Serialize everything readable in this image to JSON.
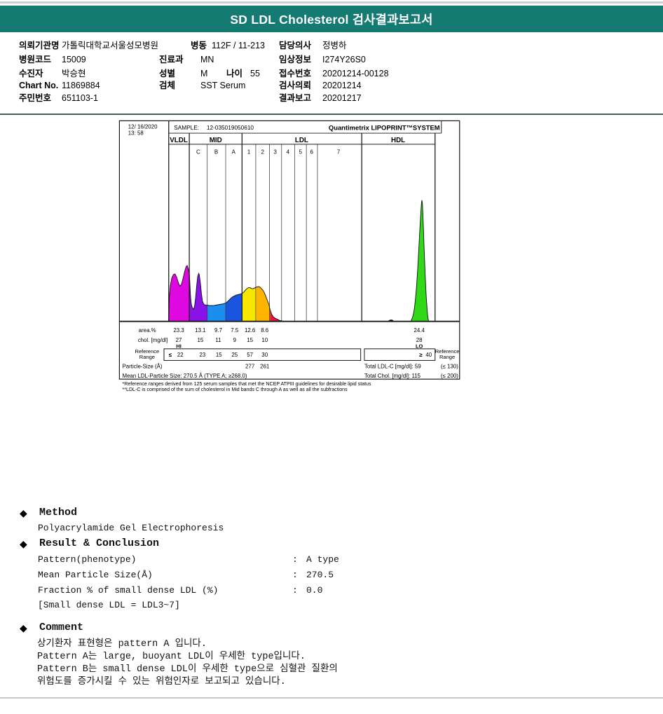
{
  "page": {
    "title": "SD LDL Cholesterol 검사결과보고서"
  },
  "patient": {
    "rows": [
      {
        "l1": "의뢰기관명",
        "v1": "가톨릭대학교서울성모병원",
        "l2": "병동",
        "v2": "112F / 11-213",
        "l3": "담당의사",
        "v3": "정병하"
      },
      {
        "l1": "병원코드",
        "v1": "15009",
        "l2": "진료과",
        "v2": "MN",
        "l3": "임상정보",
        "v3": "I274Y26S0"
      },
      {
        "l1": "수진자",
        "v1": "박승현",
        "l2": "성별",
        "v2": "M",
        "l2b": "나이",
        "v2b": "55",
        "l3": "접수번호",
        "v3": "20201214-00128"
      },
      {
        "l1": "Chart No.",
        "v1": "11869884",
        "l2": "검체",
        "v2": "SST Serum",
        "l3": "검사의뢰",
        "v3": "20201214"
      },
      {
        "l1": "주민번호",
        "v1": "651103-1",
        "l3": "결과보고",
        "v3": "20201217"
      }
    ]
  },
  "chart": {
    "datetime_line1": "12/ 16/2020",
    "datetime_line2": "13: 58",
    "sample_label": "SAMPLE:",
    "sample_id": "12-035019050610",
    "brand": "Quantimetrix LIPOPRINT™SYSTEM",
    "brand_color": "#ee00ee",
    "groups": [
      "VLDL",
      "MID",
      "LDL",
      "HDL"
    ],
    "subbands": [
      "C",
      "B",
      "A",
      "1",
      "2",
      "3",
      "4",
      "5",
      "6",
      "7"
    ],
    "row_labels": {
      "area": "area.%",
      "chol": "chol. [mg/dl]",
      "ref_line1": "Reference",
      "ref_line2": "Range",
      "particle": "Particle-Size (Å)"
    },
    "area": [
      "23.3",
      "13.1",
      "9.7",
      "7.5",
      "12.6",
      "8.6",
      "24.4"
    ],
    "chol": [
      "27",
      "15",
      "11",
      "9",
      "15",
      "10",
      "28"
    ],
    "flags": {
      "hi": "HI",
      "lo": "LO"
    },
    "ref": {
      "le": "≤",
      "values": [
        "22",
        "23",
        "15",
        "25",
        "57",
        "30"
      ],
      "ge": "≥",
      "hdl": "40"
    },
    "particle_values": [
      "277",
      "261"
    ],
    "mean_line": "Mean LDL-Particle Size:  270.5 Å  (TYPE A; ≥268.0)",
    "totals": {
      "ldl": "Total LDL-C [mg/dl]: 59",
      "ldl_ref": "(≤ 130)",
      "chol": "Total Chol. [mg/dl]: 115",
      "chol_ref": "(≤ 200)"
    },
    "footnote1": "*Reference ranges derived from 125 serum samples that met the NCEP ATPIII guidelines for desirable lipid status",
    "footnote2": "**LDL-C is comprised of the sum of cholesterol in Mid bands C through A as well as all the subfractions"
  },
  "chart_data": {
    "type": "area",
    "title": "Quantimetrix LIPOPRINT SYSTEM lipoprotein subfraction electrophoresis profile",
    "sample_id": "12-035019050610",
    "datetime": "12/ 16/2020 13: 58",
    "bands": [
      {
        "name": "VLDL",
        "area_pct": 23.3,
        "chol_mg_dl": 27,
        "flag": "HI",
        "reference": "≤ 22",
        "color": "#e008e0"
      },
      {
        "name": "MID C",
        "area_pct": 13.1,
        "chol_mg_dl": 15,
        "reference": "23",
        "color": "#8812e8"
      },
      {
        "name": "MID B",
        "area_pct": 9.7,
        "chol_mg_dl": 11,
        "reference": "15",
        "color": "#1c8ef0"
      },
      {
        "name": "MID A",
        "area_pct": 7.5,
        "chol_mg_dl": 9,
        "reference": "25",
        "color": "#1a55e0"
      },
      {
        "name": "LDL 1",
        "area_pct": 12.6,
        "chol_mg_dl": 15,
        "reference": "57",
        "particle_size_A": 277,
        "color": "#f8e800"
      },
      {
        "name": "LDL 2",
        "area_pct": 8.6,
        "chol_mg_dl": 10,
        "reference": "30",
        "particle_size_A": 261,
        "color": "#ffb400"
      },
      {
        "name": "LDL 3-7",
        "area_pct": 0.0,
        "color": "#e81438"
      },
      {
        "name": "HDL",
        "area_pct": 24.4,
        "chol_mg_dl": 28,
        "flag": "LO",
        "reference": "≥ 40",
        "color": "#30d818"
      }
    ],
    "mean_ldl_particle_size_A": 270.5,
    "pattern_type": "A",
    "total_ldl_c_mg_dl": 59,
    "total_ldl_c_ref": "≤ 130",
    "total_chol_mg_dl": 115,
    "total_chol_ref": "≤ 200",
    "legend_position": "none",
    "grid": "vertical band dividers"
  },
  "sections": {
    "method": {
      "heading": "Method",
      "body": "Polyacrylamide Gel Electrophoresis"
    },
    "result": {
      "heading": "Result & Conclusion",
      "colon": ":",
      "rows": [
        {
          "label": "Pattern(phenotype)",
          "value": "A type"
        },
        {
          "label": "Mean Particle Size(Å)",
          "value": "270.5"
        },
        {
          "label": "Fraction % of small dense LDL (%)",
          "value": "0.0"
        },
        {
          "label": "[Small dense LDL = LDL3~7]",
          "value": ""
        }
      ]
    },
    "comment": {
      "heading": "Comment",
      "lines": [
        "상기환자 표현형은 pattern A 입니다.",
        "Pattern A는 large, buoyant LDL이 우세한 type입니다.",
        "Pattern B는 small dense LDL이 우세한 type으로 심혈관 질환의",
        "위험도를 증가시킬 수 있는 위험인자로 보고되고 있습니다."
      ]
    }
  }
}
